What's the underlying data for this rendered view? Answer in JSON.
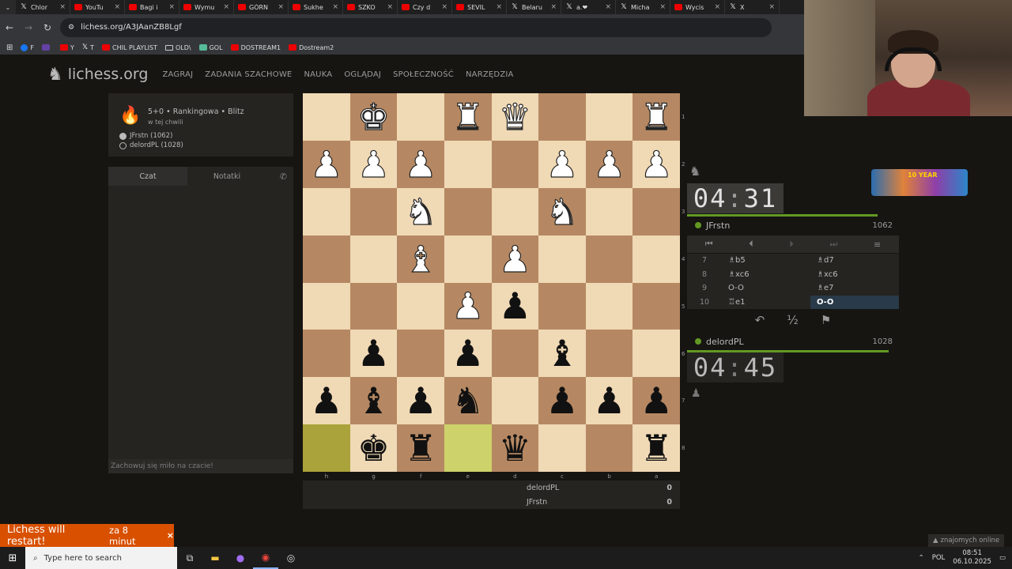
{
  "browser": {
    "tabs": [
      {
        "label": "Chlor",
        "icon": "x-icon"
      },
      {
        "label": "YouTu",
        "icon": "youtube-icon"
      },
      {
        "label": "Bagi i",
        "icon": "youtube-icon"
      },
      {
        "label": "Wymu",
        "icon": "youtube-icon"
      },
      {
        "label": "GÓRN",
        "icon": "youtube-icon"
      },
      {
        "label": "Sukhe",
        "icon": "youtube-icon"
      },
      {
        "label": "SZKO",
        "icon": "youtube-icon"
      },
      {
        "label": "Czy d",
        "icon": "youtube-icon"
      },
      {
        "label": "SEVIL",
        "icon": "youtube-icon"
      },
      {
        "label": "Belaru",
        "icon": "x-icon"
      },
      {
        "label": "a.❤",
        "icon": "x-icon"
      },
      {
        "label": "Micha",
        "icon": "x-icon"
      },
      {
        "label": "Wycis",
        "icon": "youtube-icon"
      },
      {
        "label": "X",
        "icon": "x-icon"
      }
    ],
    "url": "lichess.org/A3JAanZB8Lgf",
    "bookmarks": [
      {
        "label": "F",
        "icon": "facebook-icon"
      },
      {
        "label": "",
        "icon": "twitch-icon"
      },
      {
        "label": "Y",
        "icon": "youtube-icon"
      },
      {
        "label": "T",
        "icon": "x-icon"
      },
      {
        "label": "CHIL PLAYLIST",
        "icon": "youtube-icon"
      },
      {
        "label": "OLD\\",
        "icon": "folder-icon"
      },
      {
        "label": "GOL",
        "icon": "g-icon"
      },
      {
        "label": "DOSTREAM1",
        "icon": "youtube-icon"
      },
      {
        "label": "Dostream2",
        "icon": "youtube-icon"
      }
    ]
  },
  "header": {
    "logo": "lichess.org",
    "nav": [
      "ZAGRAJ",
      "ZADANIA SZACHOWE",
      "NAUKA",
      "OGLĄDAJ",
      "SPOŁECZNOŚĆ",
      "NARZĘDZIA"
    ]
  },
  "game_info": {
    "setup": "5+0 • Rankingowa • Blitz",
    "time": "w tej chwili",
    "white": "JFrstn (1062)",
    "black": "delordPL (1028)"
  },
  "chat": {
    "tab_chat": "Czat",
    "tab_notes": "Notatki",
    "placeholder": "Zachowuj się miło na czacie!"
  },
  "board": {
    "orientation": "black",
    "ranks": [
      "1",
      "2",
      "3",
      "4",
      "5",
      "6",
      "7",
      "8"
    ],
    "files": [
      "h",
      "g",
      "f",
      "e",
      "d",
      "c",
      "b",
      "a"
    ],
    "rows": [
      [
        "",
        "wK",
        "",
        "wR",
        "wQ",
        "",
        "",
        "wR"
      ],
      [
        "wP",
        "wP",
        "wP",
        "",
        "",
        "wP",
        "wP",
        "wP"
      ],
      [
        "",
        "",
        "wN",
        "",
        "",
        "wN",
        "",
        ""
      ],
      [
        "",
        "",
        "wB",
        "",
        "wP",
        "",
        "",
        ""
      ],
      [
        "",
        "",
        "",
        "wP",
        "bP",
        "",
        "",
        ""
      ],
      [
        "",
        "bP",
        "",
        "bP",
        "",
        "bB",
        "",
        ""
      ],
      [
        "bP",
        "bB",
        "bP",
        "bN",
        "",
        "bP",
        "bP",
        "bP"
      ],
      [
        "",
        "bK",
        "bR",
        "",
        "bQ",
        "",
        "",
        "bR"
      ]
    ],
    "last_move_squares": [
      "h8",
      "e8"
    ],
    "colors": {
      "light": "#f0d9b5",
      "dark": "#b58863",
      "last_light": "#cdd26a",
      "last_dark": "#aaa23a"
    }
  },
  "opponent": {
    "name": "JFrstn",
    "rating": "1062",
    "clock_min": "04",
    "clock_sec": "31",
    "clock_remaining_fraction": 0.9
  },
  "player": {
    "name": "delordPL",
    "rating": "1028",
    "clock_min": "04",
    "clock_sec": "45",
    "clock_remaining_fraction": 0.95
  },
  "moves": [
    {
      "n": "7",
      "w": "♗b5",
      "b": "♗d7"
    },
    {
      "n": "8",
      "w": "♗xc6",
      "b": "♗xc6"
    },
    {
      "n": "9",
      "w": "O-O",
      "b": "♗e7"
    },
    {
      "n": "10",
      "w": "♖e1",
      "b": "O-O"
    }
  ],
  "crosstable": [
    {
      "name": "delordPL",
      "score": "0"
    },
    {
      "name": "JFrstn",
      "score": "0"
    }
  ],
  "toast": {
    "title": "Lichess will restart!",
    "subtitle": "za 8 minut",
    "close": "×"
  },
  "friends_online": "znajomych online",
  "taskbar": {
    "search_placeholder": "Type here to search",
    "lang": "POL",
    "time": "08:51",
    "date": "06.10.2025"
  },
  "stream_badge_text": "10 YEAR"
}
